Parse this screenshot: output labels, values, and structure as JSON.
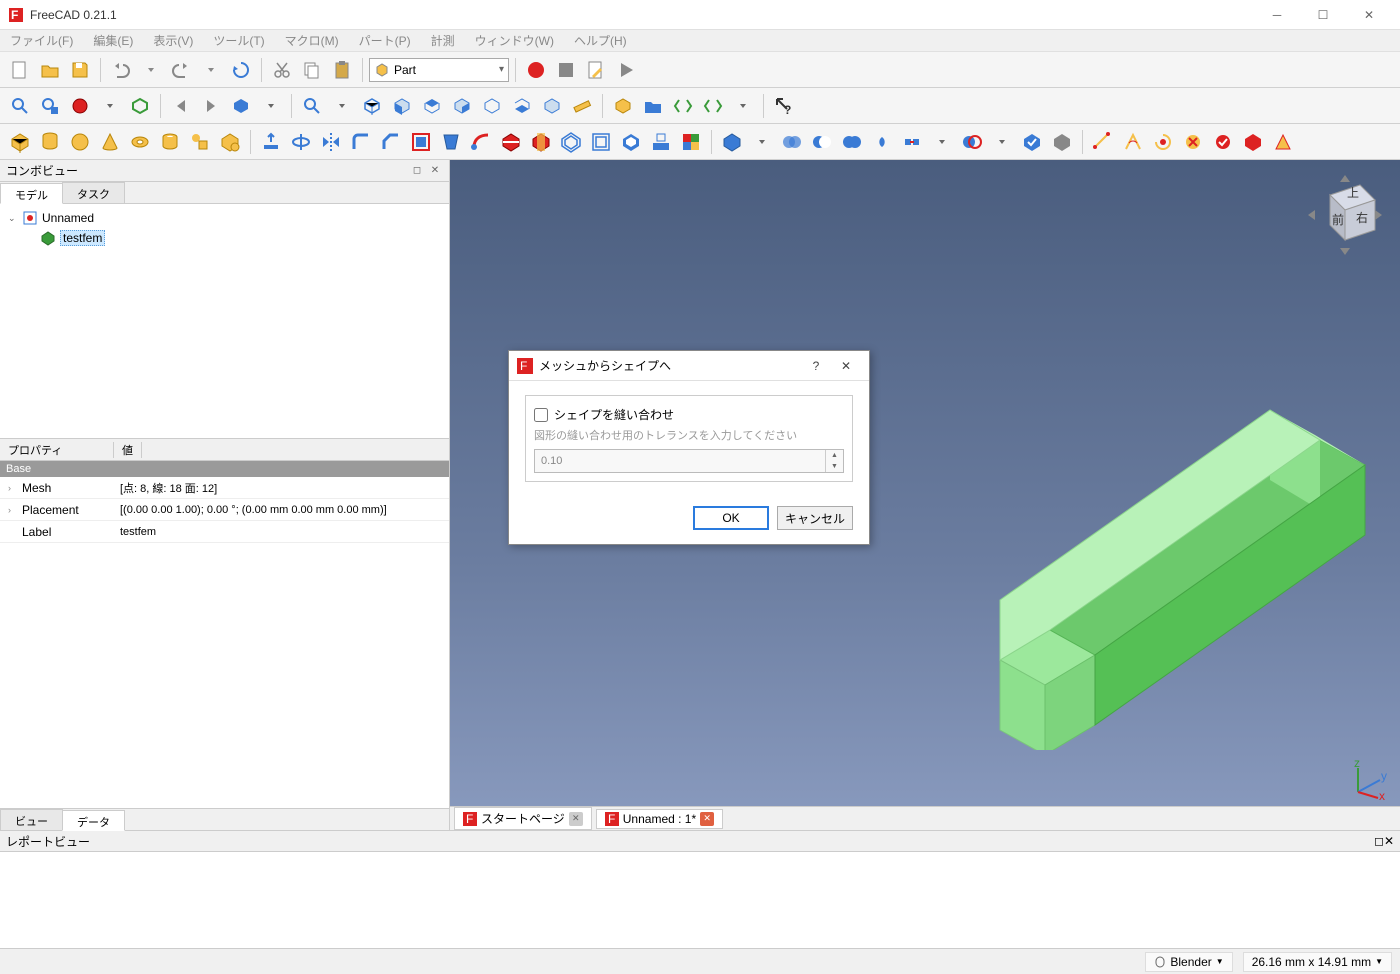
{
  "app_title": "FreeCAD 0.21.1",
  "menus": [
    "ファイル(F)",
    "編集(E)",
    "表示(V)",
    "ツール(T)",
    "マクロ(M)",
    "パート(P)",
    "計測",
    "ウィンドウ(W)",
    "ヘルプ(H)"
  ],
  "workbench": "Part",
  "panels": {
    "combo": "コンボビュー",
    "tabs": {
      "model": "モデル",
      "task": "タスク"
    },
    "prop_headers": {
      "name": "プロパティ",
      "value": "値"
    },
    "bottom_tabs": {
      "view": "ビュー",
      "data": "データ"
    },
    "report": "レポートビュー"
  },
  "tree": {
    "root": "Unnamed",
    "child": "testfem"
  },
  "props": {
    "group": "Base",
    "rows": [
      {
        "name": "Mesh",
        "value": "[点: 8, 線: 18 面: 12]"
      },
      {
        "name": "Placement",
        "value": "[(0.00 0.00 1.00); 0.00 °; (0.00 mm  0.00 mm  0.00 mm)]"
      },
      {
        "name": "Label",
        "value": "testfem"
      }
    ]
  },
  "doc_tabs": [
    {
      "label": "スタートページ",
      "close": "gray"
    },
    {
      "label": "Unnamed : 1*",
      "close": "red"
    }
  ],
  "dialog": {
    "title": "メッシュからシェイプへ",
    "checkbox": "シェイプを縫い合わせ",
    "hint": "図形の縫い合わせ用のトレランスを入力してください",
    "value": "0.10",
    "ok": "OK",
    "cancel": "キャンセル"
  },
  "status": {
    "blender": "Blender",
    "dims": "26.16 mm x 14.91 mm"
  },
  "navcube": {
    "top": "上",
    "front": "前",
    "right": "右"
  }
}
